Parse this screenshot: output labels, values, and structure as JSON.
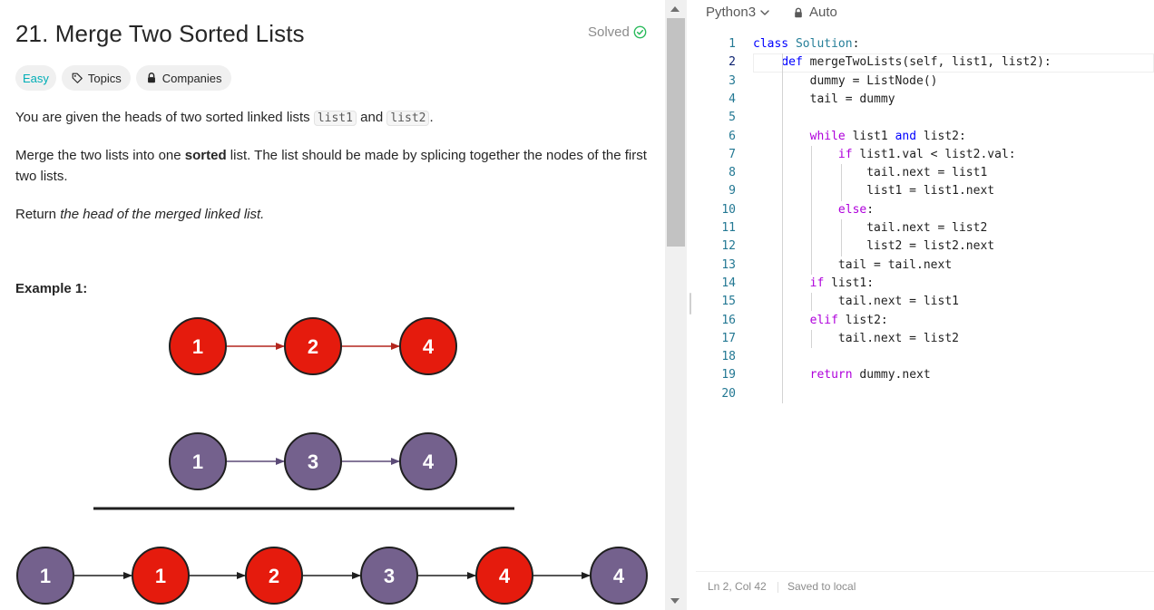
{
  "problem": {
    "title": "21. Merge Two Sorted Lists",
    "solved_label": "Solved",
    "difficulty": "Easy",
    "topics_label": "Topics",
    "companies_label": "Companies",
    "p1_a": "You are given the heads of two sorted linked lists ",
    "p1_code1": "list1",
    "p1_b": " and ",
    "p1_code2": "list2",
    "p1_c": ".",
    "p2_a": "Merge the two lists into one ",
    "p2_bold": "sorted",
    "p2_b": " list. The list should be made by splicing together the nodes of the first two lists.",
    "p3_a": "Return ",
    "p3_ital": "the head of the merged linked list.",
    "example_heading": "Example 1:"
  },
  "diagram": {
    "list1": [
      {
        "value": "1",
        "color": "red"
      },
      {
        "value": "2",
        "color": "red"
      },
      {
        "value": "4",
        "color": "red"
      }
    ],
    "list2": [
      {
        "value": "1",
        "color": "purple"
      },
      {
        "value": "3",
        "color": "purple"
      },
      {
        "value": "4",
        "color": "purple"
      }
    ],
    "merged": [
      {
        "value": "1",
        "color": "purple"
      },
      {
        "value": "1",
        "color": "red"
      },
      {
        "value": "2",
        "color": "red"
      },
      {
        "value": "3",
        "color": "purple"
      },
      {
        "value": "4",
        "color": "red"
      },
      {
        "value": "4",
        "color": "purple"
      }
    ],
    "colors": {
      "red": "#e51b0d",
      "purple": "#74618d",
      "red_arrow": "#b3261e",
      "purple_arrow": "#5b4a77",
      "black_arrow": "#1f1f1f"
    }
  },
  "editor": {
    "language": "Python3",
    "mode": "Auto",
    "cursor_position": "Ln 2, Col 42",
    "save_status": "Saved to local",
    "active_line": 2,
    "lines": [
      [
        [
          "kw",
          "class"
        ],
        [
          "",
          " "
        ],
        [
          "cls",
          "Solution"
        ],
        [
          "",
          ":"
        ]
      ],
      [
        [
          "",
          "    "
        ],
        [
          "kw",
          "def"
        ],
        [
          "",
          " mergeTwoLists(self, list1, list2):"
        ]
      ],
      [
        [
          "",
          "        dummy = ListNode()"
        ]
      ],
      [
        [
          "",
          "        tail = dummy"
        ]
      ],
      [],
      [
        [
          "",
          "        "
        ],
        [
          "ctl",
          "while"
        ],
        [
          "",
          " list1 "
        ],
        [
          "kw",
          "and"
        ],
        [
          "",
          " list2:"
        ]
      ],
      [
        [
          "",
          "            "
        ],
        [
          "ctl",
          "if"
        ],
        [
          "",
          " list1.val < list2.val:"
        ]
      ],
      [
        [
          "",
          "                tail.next = list1"
        ]
      ],
      [
        [
          "",
          "                list1 = list1.next"
        ]
      ],
      [
        [
          "",
          "            "
        ],
        [
          "ctl",
          "else"
        ],
        [
          "",
          ":"
        ]
      ],
      [
        [
          "",
          "                tail.next = list2"
        ]
      ],
      [
        [
          "",
          "                list2 = list2.next"
        ]
      ],
      [
        [
          "",
          "            tail = tail.next"
        ]
      ],
      [
        [
          "",
          "        "
        ],
        [
          "ctl",
          "if"
        ],
        [
          "",
          " list1:"
        ]
      ],
      [
        [
          "",
          "            tail.next = list1"
        ]
      ],
      [
        [
          "",
          "        "
        ],
        [
          "ctl",
          "elif"
        ],
        [
          "",
          " list2:"
        ]
      ],
      [
        [
          "",
          "            tail.next = list2"
        ]
      ],
      [],
      [
        [
          "",
          "        "
        ],
        [
          "ctl",
          "return"
        ],
        [
          "",
          " dummy.next"
        ]
      ],
      []
    ]
  }
}
